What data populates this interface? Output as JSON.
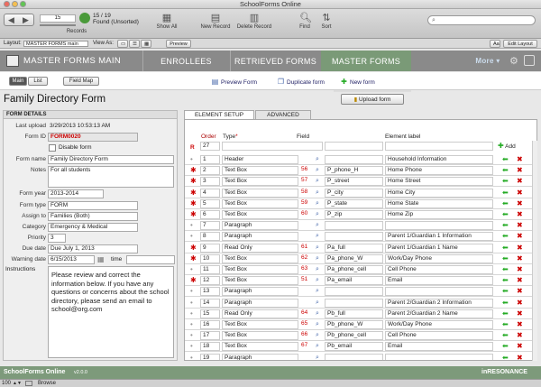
{
  "window": {
    "title": "SchoolForms Online"
  },
  "toolbar": {
    "record_number": "15",
    "records_count": "15 / 19",
    "found_status": "Found (Unsorted)",
    "records_label": "Records",
    "show_all": "Show All",
    "new_record": "New Record",
    "delete_record": "Delete Record",
    "find": "Find",
    "sort": "Sort",
    "search_placeholder": ""
  },
  "layoutbar": {
    "layout_label": "Layout:",
    "layout_value": "MASTER FORMS main",
    "view_as_label": "View As:",
    "preview": "Preview",
    "aa": "Aa",
    "edit_layout": "Edit Layout"
  },
  "nav": {
    "app_title": "MASTER FORMS MAIN",
    "tabs": [
      "ENROLLEES",
      "RETRIEVED FORMS",
      "MASTER FORMS"
    ],
    "more": "More"
  },
  "subbar": {
    "main": "Main",
    "list": "List",
    "field_map": "Field Map",
    "preview_form": "Preview Form",
    "duplicate_form": "Duplicate form",
    "new_form": "New form",
    "upload_form": "Upload form"
  },
  "form": {
    "title": "Family Directory Form",
    "details_header": "FORM DETAILS",
    "last_upload_label": "Last upload",
    "last_upload": "3/29/2013 10:53:13 AM",
    "form_id_label": "Form ID",
    "form_id": "FORM0020",
    "disable_form": "Disable form",
    "form_name_label": "Form name",
    "form_name": "Family Directory Form",
    "notes_label": "Notes",
    "notes": "For all students",
    "form_year_label": "Form year",
    "form_year": "2013-2014",
    "form_type_label": "Form type",
    "form_type": "FORM",
    "assign_to_label": "Assign to",
    "assign_to": "Families (Both)",
    "category_label": "Category",
    "category": "Emergency & Medical",
    "priority_label": "Priority",
    "priority": "3",
    "due_date_label": "Due date",
    "due_date": "Due July 1, 2013",
    "warning_date_label": "Warning date",
    "warning_date": "6/15/2013",
    "time_label": "time",
    "instructions_label": "Instructions",
    "instructions": "Please review and correct the information below. If you have any questions or concerns about the school directory, please send an email to school@org.com"
  },
  "setup": {
    "tab_element": "ELEMENT SETUP",
    "tab_advanced": "ADVANCED",
    "col_order": "Order",
    "col_type": "Type",
    "col_field": "Field",
    "col_element_label": "Element label",
    "new_order": "27",
    "add": "Add",
    "rows": [
      {
        "order": "1",
        "type": "Header",
        "num": "",
        "field": "",
        "label": "Household Information",
        "req": false
      },
      {
        "order": "2",
        "type": "Text Box",
        "num": "56",
        "field": "P_phone_H",
        "label": "Home Phone",
        "req": true
      },
      {
        "order": "3",
        "type": "Text Box",
        "num": "57",
        "field": "P_street",
        "label": "Home Street",
        "req": true
      },
      {
        "order": "4",
        "type": "Text Box",
        "num": "58",
        "field": "P_city",
        "label": "Home City",
        "req": true
      },
      {
        "order": "5",
        "type": "Text Box",
        "num": "59",
        "field": "P_state",
        "label": "Home State",
        "req": true
      },
      {
        "order": "6",
        "type": "Text Box",
        "num": "60",
        "field": "P_zip",
        "label": "Home Zip",
        "req": true
      },
      {
        "order": "7",
        "type": "Paragraph",
        "num": "",
        "field": "",
        "label": "",
        "req": false
      },
      {
        "order": "8",
        "type": "Paragraph",
        "num": "",
        "field": "",
        "label": "Parent 1/Guardian 1 Information",
        "req": false
      },
      {
        "order": "9",
        "type": "Read Only",
        "num": "61",
        "field": "Pa_full",
        "label": "Parent 1/Guardian 1 Name",
        "req": true
      },
      {
        "order": "10",
        "type": "Text Box",
        "num": "62",
        "field": "Pa_phone_W",
        "label": "Work/Day Phone",
        "req": true
      },
      {
        "order": "11",
        "type": "Text Box",
        "num": "63",
        "field": "Pa_phone_cell",
        "label": "Cell Phone",
        "req": false
      },
      {
        "order": "12",
        "type": "Text Box",
        "num": "51",
        "field": "Pa_email",
        "label": "Email",
        "req": true
      },
      {
        "order": "13",
        "type": "Paragraph",
        "num": "",
        "field": "",
        "label": "",
        "req": false
      },
      {
        "order": "14",
        "type": "Paragraph",
        "num": "",
        "field": "",
        "label": "Parent 2/Guardian 2 Information",
        "req": false
      },
      {
        "order": "15",
        "type": "Read Only",
        "num": "64",
        "field": "Pb_full",
        "label": "Parent 2/Guardian 2 Name",
        "req": false
      },
      {
        "order": "16",
        "type": "Text Box",
        "num": "65",
        "field": "Pb_phone_W",
        "label": "Work/Day Phone",
        "req": false
      },
      {
        "order": "17",
        "type": "Text Box",
        "num": "66",
        "field": "Pb_phone_cell",
        "label": "Cell Phone",
        "req": false
      },
      {
        "order": "18",
        "type": "Text Box",
        "num": "67",
        "field": "Pb_email",
        "label": "Email",
        "req": false
      },
      {
        "order": "19",
        "type": "Paragraph",
        "num": "",
        "field": "",
        "label": "",
        "req": false
      }
    ]
  },
  "status": {
    "app": "SchoolForms Online",
    "version": "v2.0.0",
    "brand": "inRESONANCE",
    "zoom": "100",
    "mode": "Browse"
  },
  "colors": {
    "green": "#7d9a7b",
    "nav_active": "#7a9a77",
    "required": "#c00",
    "form_id": "#c00"
  }
}
